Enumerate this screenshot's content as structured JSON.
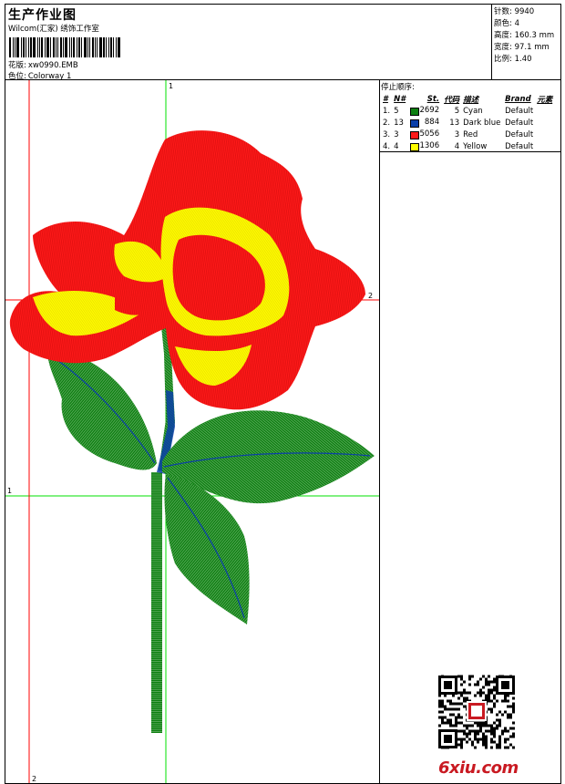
{
  "header": {
    "title": "生产作业图",
    "company": "Wilcom(汇家) 绣饰工作室",
    "pattern_label": "花版:",
    "pattern_value": "xw0990.EMB",
    "colorway_label": "色位:",
    "colorway_value": "Colorway 1"
  },
  "specs": [
    {
      "label": "针数:",
      "value": "9940"
    },
    {
      "label": "颜色:",
      "value": "4"
    },
    {
      "label": "高度:",
      "value": "160.3 mm"
    },
    {
      "label": "宽度:",
      "value": "97.1 mm"
    },
    {
      "label": "比例:",
      "value": "1.40"
    }
  ],
  "stop_sequence": {
    "title": "停止顺序:",
    "columns": [
      "#",
      "N#",
      "St.",
      "代码",
      "描述",
      "Brand",
      "元素"
    ],
    "rows": [
      {
        "num": "1.",
        "n": "5",
        "color": "#0d7f10",
        "st": "2692",
        "code": "5",
        "desc": "Cyan",
        "brand": "Default"
      },
      {
        "num": "2.",
        "n": "13",
        "color": "#0b3fa8",
        "st": "884",
        "code": "13",
        "desc": "Dark blue",
        "brand": "Default"
      },
      {
        "num": "3.",
        "n": "3",
        "color": "#ff1a1a",
        "st": "5056",
        "code": "3",
        "desc": "Red",
        "brand": "Default"
      },
      {
        "num": "4.",
        "n": "4",
        "color": "#ffff00",
        "st": "1306",
        "code": "4",
        "desc": "Yellow",
        "brand": "Default"
      }
    ]
  },
  "axes": {
    "v1_top": "1",
    "h2_right": "2",
    "h1_left": "1",
    "v2_bottom": "2"
  },
  "colors": {
    "guide_green": "#00e000",
    "guide_red": "#ff0000",
    "leaf_green": "#0d7f10",
    "petal_red": "#ff1a1a",
    "petal_yellow": "#ffff00",
    "stem_blue": "#0b3fa8"
  },
  "watermark": "6xiu.com"
}
